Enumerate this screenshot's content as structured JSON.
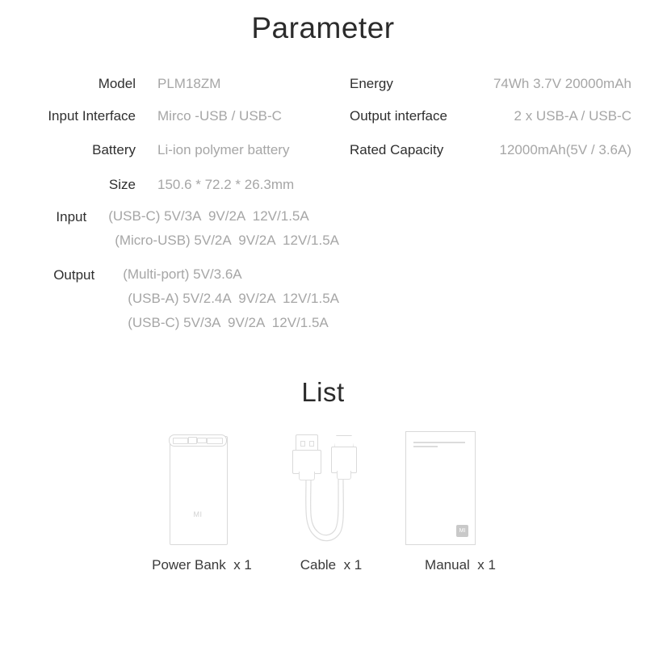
{
  "sections": {
    "parameter_title": "Parameter",
    "list_title": "List"
  },
  "parameters": {
    "rows": [
      {
        "left": {
          "label": "Model",
          "value": "PLM18ZM"
        },
        "right": {
          "label": "Energy",
          "value": "74Wh 3.7V 20000mAh"
        }
      },
      {
        "left": {
          "label": "Input Interface",
          "value": "Mirco -USB / USB-C"
        },
        "right": {
          "label": "Output interface",
          "value": "2 x USB-A / USB-C"
        }
      },
      {
        "left": {
          "label": "Battery",
          "value": "Li-ion polymer battery"
        },
        "right": {
          "label": "Rated Capacity",
          "value": "12000mAh(5V / 3.6A)"
        }
      }
    ],
    "size": {
      "label": "Size",
      "value": "150.6 * 72.2 * 26.3mm"
    },
    "input": {
      "label": "Input",
      "lines": [
        "(USB-C) 5V/3A  9V/2A  12V/1.5A",
        "(Micro-USB) 5V/2A  9V/2A  12V/1.5A"
      ]
    },
    "output": {
      "label": "Output",
      "lines": [
        "(Multi-port) 5V/3.6A",
        "(USB-A) 5V/2.4A  9V/2A  12V/1.5A",
        "(USB-C) 5V/3A  9V/2A  12V/1.5A"
      ]
    }
  },
  "package_list": {
    "items": [
      {
        "name": "power-bank",
        "caption": "Power Bank  x 1",
        "logo": "MI"
      },
      {
        "name": "cable",
        "caption": "Cable  x 1"
      },
      {
        "name": "manual",
        "caption": "Manual  x 1",
        "badge": "MI"
      }
    ]
  },
  "colors": {
    "label_text": "#2f2f2f",
    "value_text": "#a6a6a6",
    "title_text": "#2b2b2b",
    "line_art": "#d9d9d9",
    "background": "#ffffff"
  }
}
